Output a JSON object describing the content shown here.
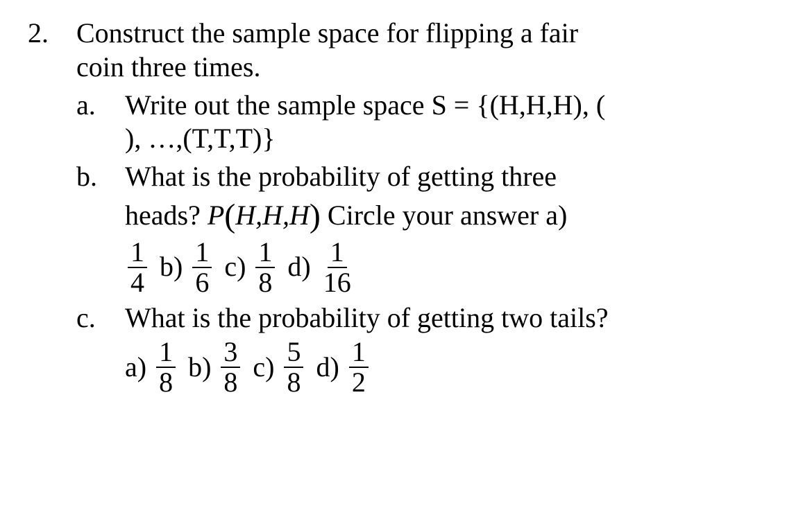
{
  "problem": {
    "number": "2.",
    "stem_line1": "Construct the sample space for flipping a fair",
    "stem_line2": "coin three times.",
    "parts": {
      "a": {
        "letter": "a.",
        "line1": "Write out the sample space S = {(H,H,H), (",
        "line2": "), …,(T,T,T)}"
      },
      "b": {
        "letter": "b.",
        "line1": "What is the probability of getting three",
        "line2_prefix": "heads?  ",
        "expr_P": "P",
        "expr_args": "H,H,H",
        "line2_suffix": " Circle your answer a)",
        "options": {
          "a_frac": {
            "num": "1",
            "den": "4"
          },
          "b_label": "b)",
          "b_frac": {
            "num": "1",
            "den": "6"
          },
          "c_label": "c)",
          "c_frac": {
            "num": "1",
            "den": "8"
          },
          "d_label": "d)",
          "d_frac": {
            "num": "1",
            "den": "16"
          }
        }
      },
      "c": {
        "letter": "c.",
        "line1": "What is the probability of getting two tails?",
        "options": {
          "a_label": "a)",
          "a_frac": {
            "num": "1",
            "den": "8"
          },
          "b_label": "b)",
          "b_frac": {
            "num": "3",
            "den": "8"
          },
          "c_label": "c)",
          "c_frac": {
            "num": "5",
            "den": "8"
          },
          "d_label": "d)",
          "d_frac": {
            "num": "1",
            "den": "2"
          }
        }
      }
    }
  }
}
